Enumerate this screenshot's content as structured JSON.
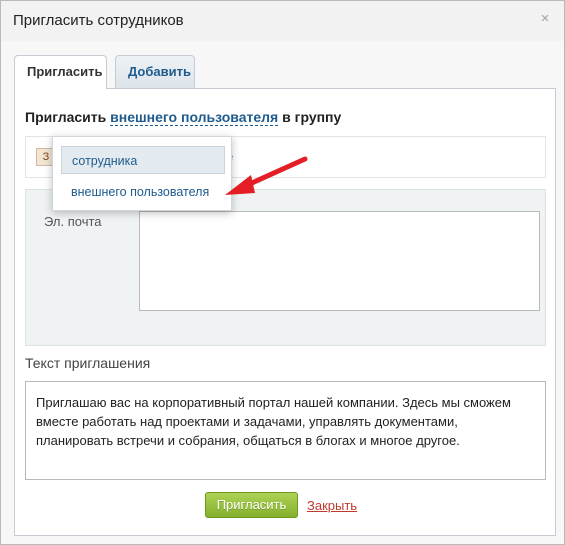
{
  "window": {
    "title": "Пригласить сотрудников",
    "close_symbol": "×"
  },
  "tabs": [
    {
      "label": "Пригласить",
      "active": true
    },
    {
      "label": "Добавить",
      "active": false
    }
  ],
  "heading": {
    "prefix": "Пригласить",
    "link": "внешнего пользователя",
    "suffix": "в группу"
  },
  "row_bar": {
    "button_text": "З",
    "trailing_text": "е"
  },
  "dropdown": {
    "items": [
      "сотрудника",
      "внешнего пользователя"
    ],
    "selected_index": 0
  },
  "email": {
    "label": "Эл. почта",
    "value": ""
  },
  "message": {
    "label": "Текст приглашения",
    "text": "Приглашаю вас на корпоративный портал нашей компании. Здесь мы сможем вместе работать над проектами и задачами, управлять документами, планировать встречи и собрания, общаться в блогах и многое другое."
  },
  "actions": {
    "invite_label": "Пригласить",
    "close_label": "Закрыть"
  },
  "colors": {
    "link": "#1f5b8d",
    "invite_button": "#95bf3a",
    "close_link": "#c0392b",
    "annotation_arrow": "#e31e24"
  }
}
